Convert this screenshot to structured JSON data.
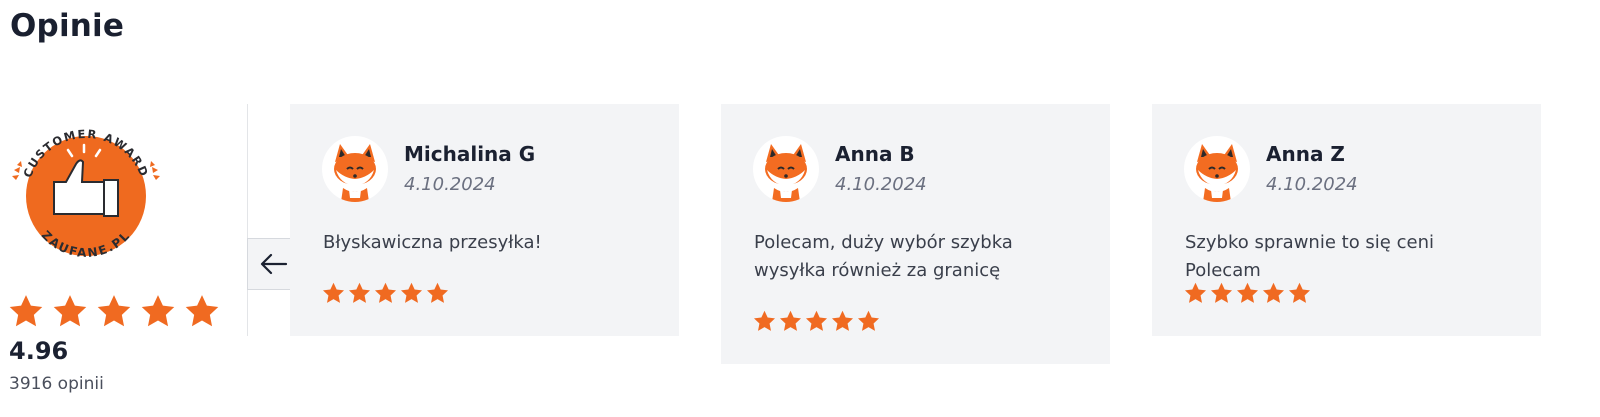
{
  "section": {
    "title": "Opinie"
  },
  "award": {
    "badge_top_text": "CUSTOMER AWARD",
    "badge_bottom_text": "ZAUFANE.PL",
    "rating": "4.96",
    "reviews_count": "3916 opinii",
    "stars": 5
  },
  "colors": {
    "accent": "#f06a21",
    "card_bg": "#f3f4f6",
    "text": "#1b2131"
  },
  "icons": {
    "prev": "arrow-left-icon",
    "star": "star-icon",
    "avatar": "fox-avatar-icon"
  },
  "reviews": [
    {
      "name": "Michalina G",
      "date": "4.10.2024",
      "text": "Błyskawiczna przesyłka!",
      "stars": 5
    },
    {
      "name": "Anna B",
      "date": "4.10.2024",
      "text": "Polecam, duży wybór szybka wysyłka również za granicę",
      "stars": 5
    },
    {
      "name": "Anna Z",
      "date": "4.10.2024",
      "text": "Szybko sprawnie to się ceni Polecam",
      "stars": 5
    }
  ]
}
